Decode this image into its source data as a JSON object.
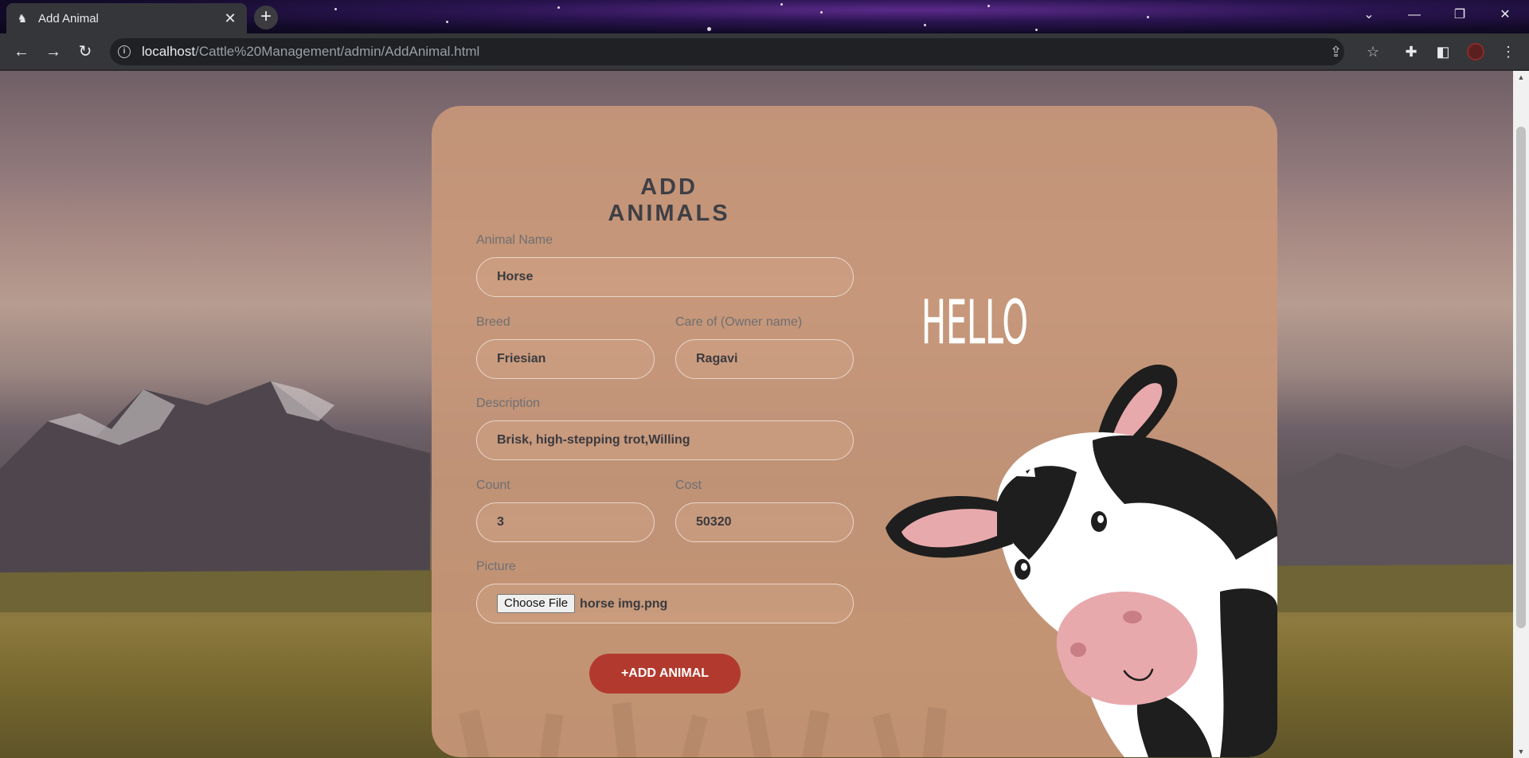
{
  "browser": {
    "tab_title": "Add Animal",
    "url_host": "localhost",
    "url_path": "/Cattle%20Management/admin/AddAnimal.html"
  },
  "form": {
    "title": "ADD ANIMALS",
    "animal_name_label": "Animal Name",
    "animal_name_value": "Horse",
    "breed_label": "Breed",
    "breed_value": "Friesian",
    "owner_label": "Care of (Owner name)",
    "owner_value": "Ragavi",
    "description_label": "Description",
    "description_value": "Brisk, high-stepping trot,Willing",
    "count_label": "Count",
    "count_value": "3",
    "cost_label": "Cost",
    "cost_value": "50320",
    "picture_label": "Picture",
    "file_button_label": "Choose File",
    "file_name": "horse img.png",
    "submit_label": "+ADD ANIMAL"
  },
  "art": {
    "greeting": "HELLO"
  },
  "colors": {
    "card": "#c79778",
    "submit": "#b2392e",
    "title": "#3f3f45"
  },
  "icons": [
    "favicon-icon",
    "close-icon",
    "plus-icon",
    "back-icon",
    "forward-icon",
    "reload-icon",
    "info-icon",
    "share-icon",
    "star-icon",
    "extensions-icon",
    "sidepanel-icon",
    "menu-icon"
  ]
}
